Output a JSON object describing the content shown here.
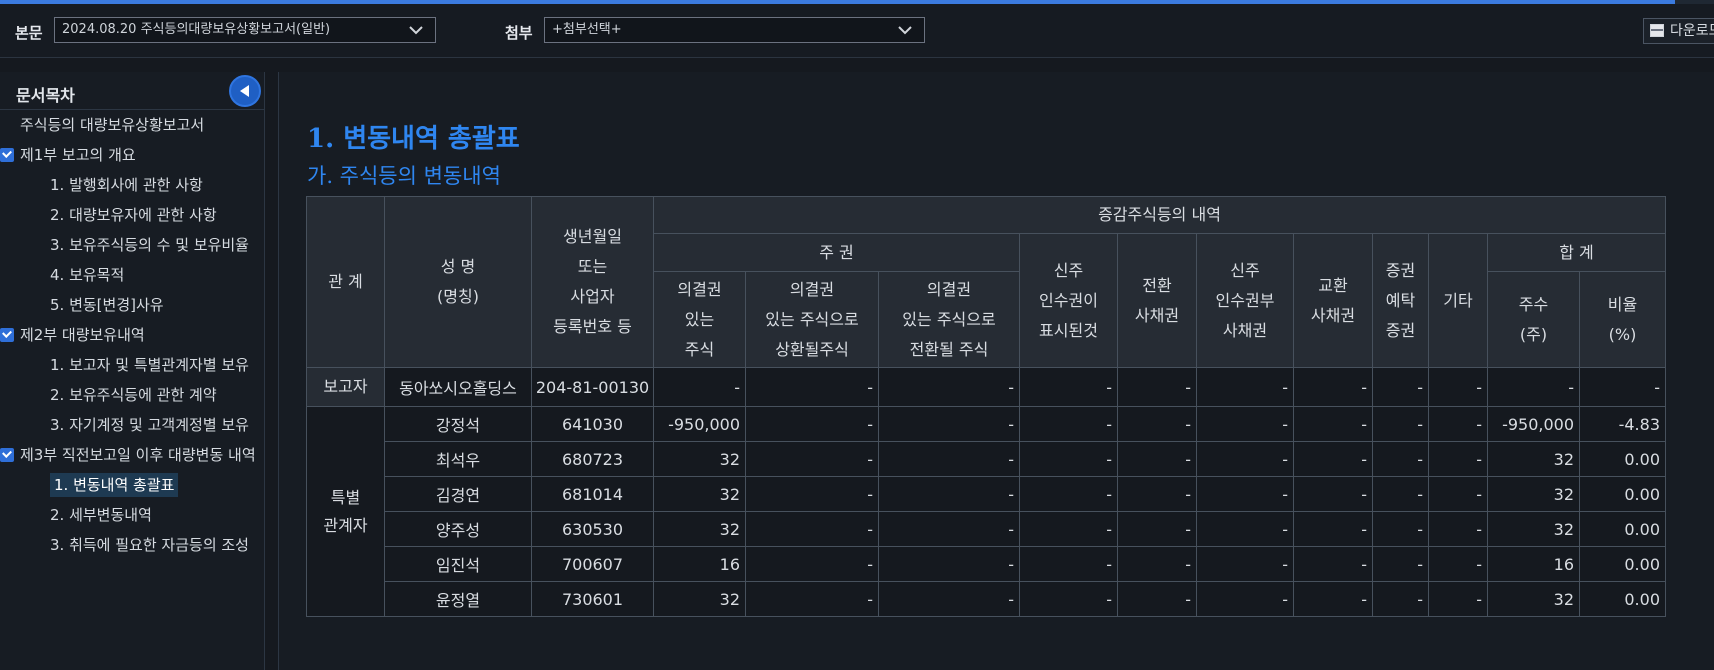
{
  "header": {
    "body_label": "본문",
    "body_select_value": "2024.08.20  주식등의대량보유상황보고서(일반)",
    "attach_label": "첨부",
    "attach_select_value": "+첨부선택+",
    "download_label": "다운로드"
  },
  "sidebar": {
    "title": "문서목차",
    "items": [
      {
        "label": "주식등의 대량보유상황보고서",
        "level": 0
      },
      {
        "label": "제1부 보고의 개요",
        "level": 1
      },
      {
        "label": "1. 발행회사에 관한 사항",
        "level": 2
      },
      {
        "label": "2. 대량보유자에 관한 사항",
        "level": 2
      },
      {
        "label": "3. 보유주식등의 수 및 보유비율",
        "level": 2
      },
      {
        "label": "4. 보유목적",
        "level": 2
      },
      {
        "label": "5. 변동[변경]사유",
        "level": 2
      },
      {
        "label": "제2부 대량보유내역",
        "level": 1
      },
      {
        "label": "1. 보고자 및 특별관계자별 보유",
        "level": 2
      },
      {
        "label": "2. 보유주식등에 관한 계약",
        "level": 2
      },
      {
        "label": "3. 자기계정 및 고객계정별 보유",
        "level": 2
      },
      {
        "label": "제3부 직전보고일 이후 대량변동 내역",
        "level": 1
      },
      {
        "label": "1. 변동내역 총괄표",
        "level": 2
      },
      {
        "label": "2. 세부변동내역",
        "level": 2
      },
      {
        "label": "3. 취득에 필요한 자금등의 조성",
        "level": 2
      }
    ]
  },
  "content": {
    "heading": "1. 변동내역 총괄표",
    "subheading": "가. 주식등의 변동내역",
    "table": {
      "header": {
        "relation": "관 계",
        "name_line1": "성 명",
        "name_line2": "(명칭)",
        "birth_line1": "생년월일",
        "birth_line2": "또는",
        "birth_line3": "사업자",
        "birth_line4": "등록번호 등",
        "increase": "증감주식등의 내역",
        "stock": "주 권",
        "voting_line1": "의결권",
        "voting_line2": "있는",
        "voting_line3": "주식",
        "redeem_line1": "의결권",
        "redeem_line2": "있는 주식으로",
        "redeem_line3": "상환될주식",
        "convert_line1": "의결권",
        "convert_line2": "있는 주식으로",
        "convert_line3": "전환될 주식",
        "warrant_line1": "신주",
        "warrant_line2": "인수권이",
        "warrant_line3": "표시된것",
        "conv_bond_line1": "전환",
        "conv_bond_line2": "사채권",
        "bw_line1": "신주",
        "bw_line2": "인수권부",
        "bw_line3": "사채권",
        "exch_line1": "교환",
        "exch_line2": "사채권",
        "dr_line1": "증권",
        "dr_line2": "예탁",
        "dr_line3": "증권",
        "other": "기타",
        "total": "합 계",
        "shares_line1": "주수",
        "shares_line2": "(주)",
        "ratio_line1": "비율",
        "ratio_line2": "(%)"
      },
      "reporter_relation": "보고자",
      "special_relation_line1": "특별",
      "special_relation_line2": "관계자",
      "rows": [
        {
          "name": "동아쏘시오홀딩스",
          "id": "204-81-00130",
          "voting": "-",
          "redeem": "-",
          "convert": "-",
          "warrant": "-",
          "conv_bond": "-",
          "bw": "-",
          "exch": "-",
          "dr": "-",
          "other": "-",
          "shares": "-",
          "ratio": "-"
        },
        {
          "name": "강정석",
          "id": "641030",
          "voting": "-950,000",
          "redeem": "-",
          "convert": "-",
          "warrant": "-",
          "conv_bond": "-",
          "bw": "-",
          "exch": "-",
          "dr": "-",
          "other": "-",
          "shares": "-950,000",
          "ratio": "-4.83"
        },
        {
          "name": "최석우",
          "id": "680723",
          "voting": "32",
          "redeem": "-",
          "convert": "-",
          "warrant": "-",
          "conv_bond": "-",
          "bw": "-",
          "exch": "-",
          "dr": "-",
          "other": "-",
          "shares": "32",
          "ratio": "0.00"
        },
        {
          "name": "김경연",
          "id": "681014",
          "voting": "32",
          "redeem": "-",
          "convert": "-",
          "warrant": "-",
          "conv_bond": "-",
          "bw": "-",
          "exch": "-",
          "dr": "-",
          "other": "-",
          "shares": "32",
          "ratio": "0.00"
        },
        {
          "name": "양주성",
          "id": "630530",
          "voting": "32",
          "redeem": "-",
          "convert": "-",
          "warrant": "-",
          "conv_bond": "-",
          "bw": "-",
          "exch": "-",
          "dr": "-",
          "other": "-",
          "shares": "32",
          "ratio": "0.00"
        },
        {
          "name": "임진석",
          "id": "700607",
          "voting": "16",
          "redeem": "-",
          "convert": "-",
          "warrant": "-",
          "conv_bond": "-",
          "bw": "-",
          "exch": "-",
          "dr": "-",
          "other": "-",
          "shares": "16",
          "ratio": "0.00"
        },
        {
          "name": "윤정열",
          "id": "730601",
          "voting": "32",
          "redeem": "-",
          "convert": "-",
          "warrant": "-",
          "conv_bond": "-",
          "bw": "-",
          "exch": "-",
          "dr": "-",
          "other": "-",
          "shares": "32",
          "ratio": "0.00"
        }
      ]
    }
  },
  "colors": {
    "accent": "#2f86f0",
    "background": "#15191f",
    "header_cell": "#262c34"
  }
}
